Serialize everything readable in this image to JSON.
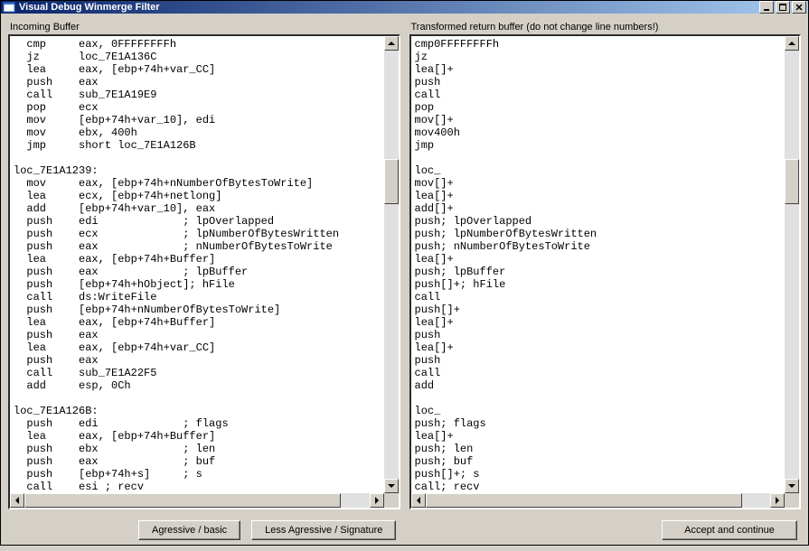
{
  "window": {
    "title": "Visual Debug Winmerge Filter"
  },
  "labels": {
    "left": "Incoming Buffer",
    "right": "Transformed return buffer (do not change line numbers!)"
  },
  "code": {
    "left": "  cmp     eax, 0FFFFFFFFh\n  jz      loc_7E1A136C\n  lea     eax, [ebp+74h+var_CC]\n  push    eax\n  call    sub_7E1A19E9\n  pop     ecx\n  mov     [ebp+74h+var_10], edi\n  mov     ebx, 400h\n  jmp     short loc_7E1A126B\n\nloc_7E1A1239:\n  mov     eax, [ebp+74h+nNumberOfBytesToWrite]\n  lea     ecx, [ebp+74h+netlong]\n  add     [ebp+74h+var_10], eax\n  push    edi             ; lpOverlapped\n  push    ecx             ; lpNumberOfBytesWritten\n  push    eax             ; nNumberOfBytesToWrite\n  lea     eax, [ebp+74h+Buffer]\n  push    eax             ; lpBuffer\n  push    [ebp+74h+hObject]; hFile\n  call    ds:WriteFile\n  push    [ebp+74h+nNumberOfBytesToWrite]\n  lea     eax, [ebp+74h+Buffer]\n  push    eax\n  lea     eax, [ebp+74h+var_CC]\n  push    eax\n  call    sub_7E1A22F5\n  add     esp, 0Ch\n\nloc_7E1A126B:\n  push    edi             ; flags\n  lea     eax, [ebp+74h+Buffer]\n  push    ebx             ; len\n  push    eax             ; buf\n  push    [ebp+74h+s]     ; s\n  call    esi ; recv\n  cmp     eax, edi",
    "right": "cmp0FFFFFFFFh\njz\nlea[]+\npush\ncall\npop\nmov[]+\nmov400h\njmp\n\nloc_\nmov[]+\nlea[]+\nadd[]+\npush; lpOverlapped\npush; lpNumberOfBytesWritten\npush; nNumberOfBytesToWrite\nlea[]+\npush; lpBuffer\npush[]+; hFile\ncall\npush[]+\nlea[]+\npush\nlea[]+\npush\ncall\nadd\n\nloc_\npush; flags\nlea[]+\npush; len\npush; buf\npush[]+; s\ncall; recv\ncmp"
  },
  "buttons": {
    "agressive": "Agressive / basic",
    "less_agressive": "Less Agressive / Signature",
    "accept": "Accept and continue"
  }
}
